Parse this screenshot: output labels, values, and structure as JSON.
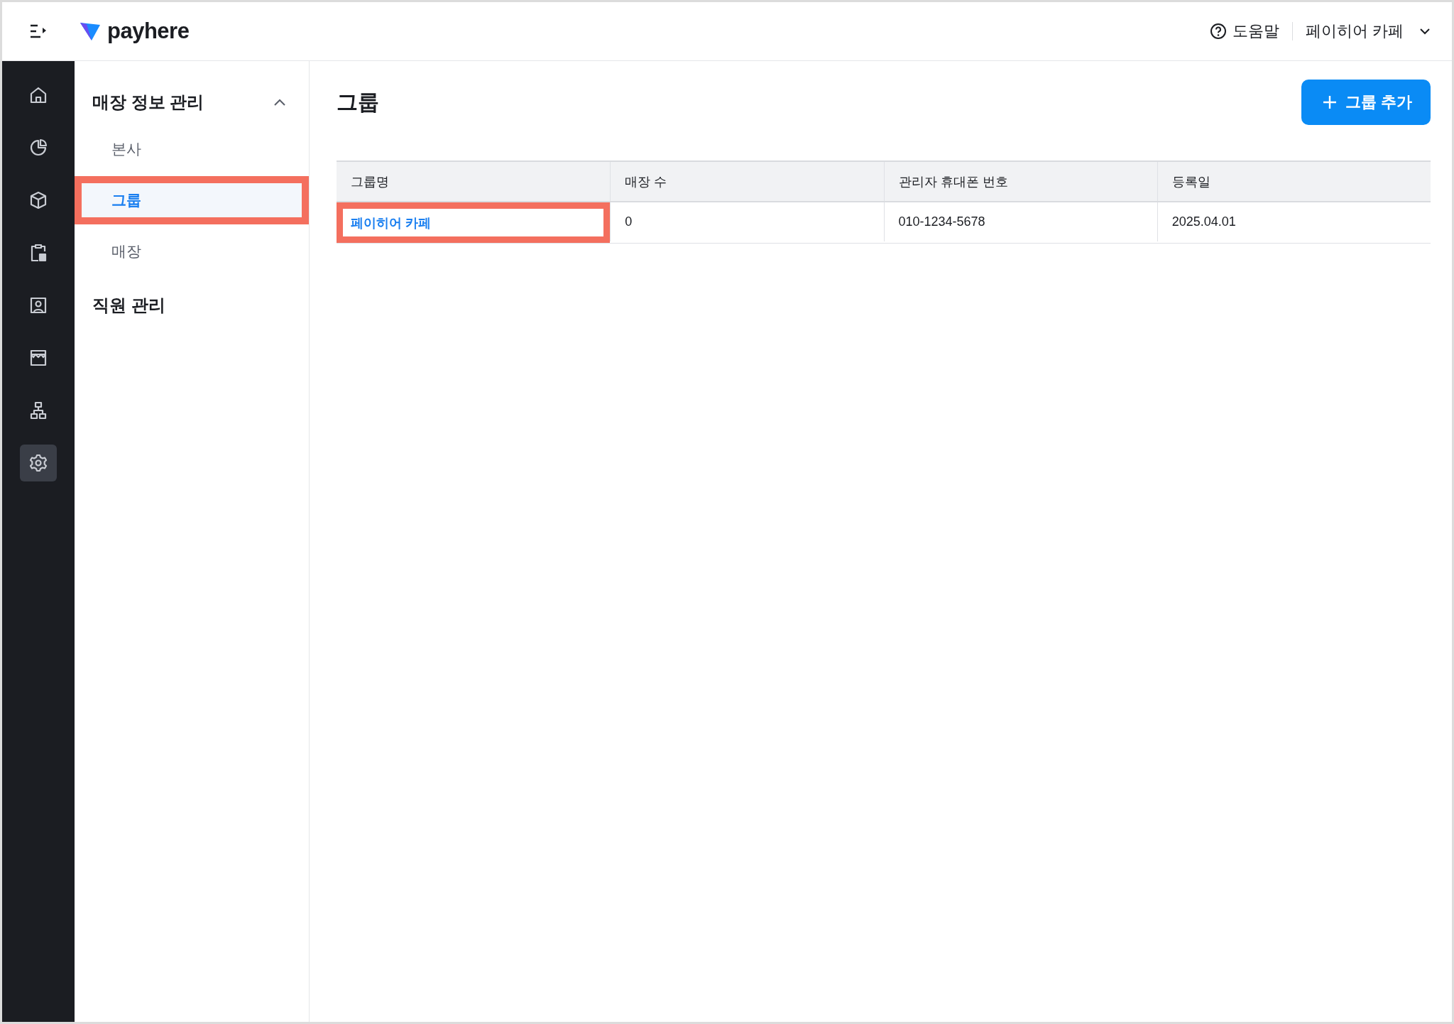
{
  "header": {
    "logo": "payhere",
    "help": "도움말",
    "store": "페이히어 카페"
  },
  "rail": [
    {
      "kind": "home",
      "selected": false
    },
    {
      "kind": "chart",
      "selected": false
    },
    {
      "kind": "cube",
      "selected": false
    },
    {
      "kind": "clipboard",
      "selected": false
    },
    {
      "kind": "contact",
      "selected": false
    },
    {
      "kind": "store",
      "selected": false
    },
    {
      "kind": "org",
      "selected": false
    },
    {
      "kind": "settings",
      "selected": true
    }
  ],
  "menu": [
    {
      "label": "매장 정보 관리",
      "expanded": true,
      "children": [
        {
          "label": "본사",
          "selected": false,
          "highlighted": false
        },
        {
          "label": "그룹",
          "selected": true,
          "highlighted": true
        },
        {
          "label": "매장",
          "selected": false,
          "highlighted": false
        }
      ]
    },
    {
      "label": "직원 관리"
    }
  ],
  "page": {
    "title": "그룹",
    "add_button": "그룹 추가"
  },
  "table": {
    "columns": [
      "그룹명",
      "매장 수",
      "관리자 휴대폰 번호",
      "등록일"
    ],
    "rows": [
      {
        "cells": [
          "페이히어 카페",
          "0",
          "010-1234-5678",
          "2025.04.01"
        ],
        "highlighted": true
      }
    ]
  }
}
